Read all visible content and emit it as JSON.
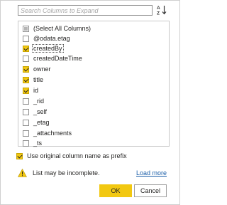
{
  "search": {
    "placeholder": "Search Columns to Expand",
    "value": ""
  },
  "sort_button": {
    "icon": "sort-az-icon",
    "label": "AZ"
  },
  "columns": [
    {
      "label": "(Select All Columns)",
      "state": "partial"
    },
    {
      "label": "@odata.etag",
      "state": "unchecked"
    },
    {
      "label": "createdBy",
      "state": "checked",
      "focused": true
    },
    {
      "label": "createdDateTime",
      "state": "unchecked"
    },
    {
      "label": "owner",
      "state": "checked"
    },
    {
      "label": "title",
      "state": "checked"
    },
    {
      "label": "id",
      "state": "checked"
    },
    {
      "label": "_rid",
      "state": "unchecked"
    },
    {
      "label": "_self",
      "state": "unchecked"
    },
    {
      "label": "_etag",
      "state": "unchecked"
    },
    {
      "label": "_attachments",
      "state": "unchecked"
    },
    {
      "label": "_ts",
      "state": "unchecked"
    }
  ],
  "prefix_option": {
    "label": "Use original column name as prefix",
    "checked": true
  },
  "warning": {
    "icon": "warning-icon",
    "text": "List may be incomplete."
  },
  "load_more": {
    "label": "Load more"
  },
  "buttons": {
    "ok": "OK",
    "cancel": "Cancel"
  },
  "colors": {
    "accent": "#f2c811",
    "link": "#1a5ea8",
    "warning": "#f2c811"
  }
}
